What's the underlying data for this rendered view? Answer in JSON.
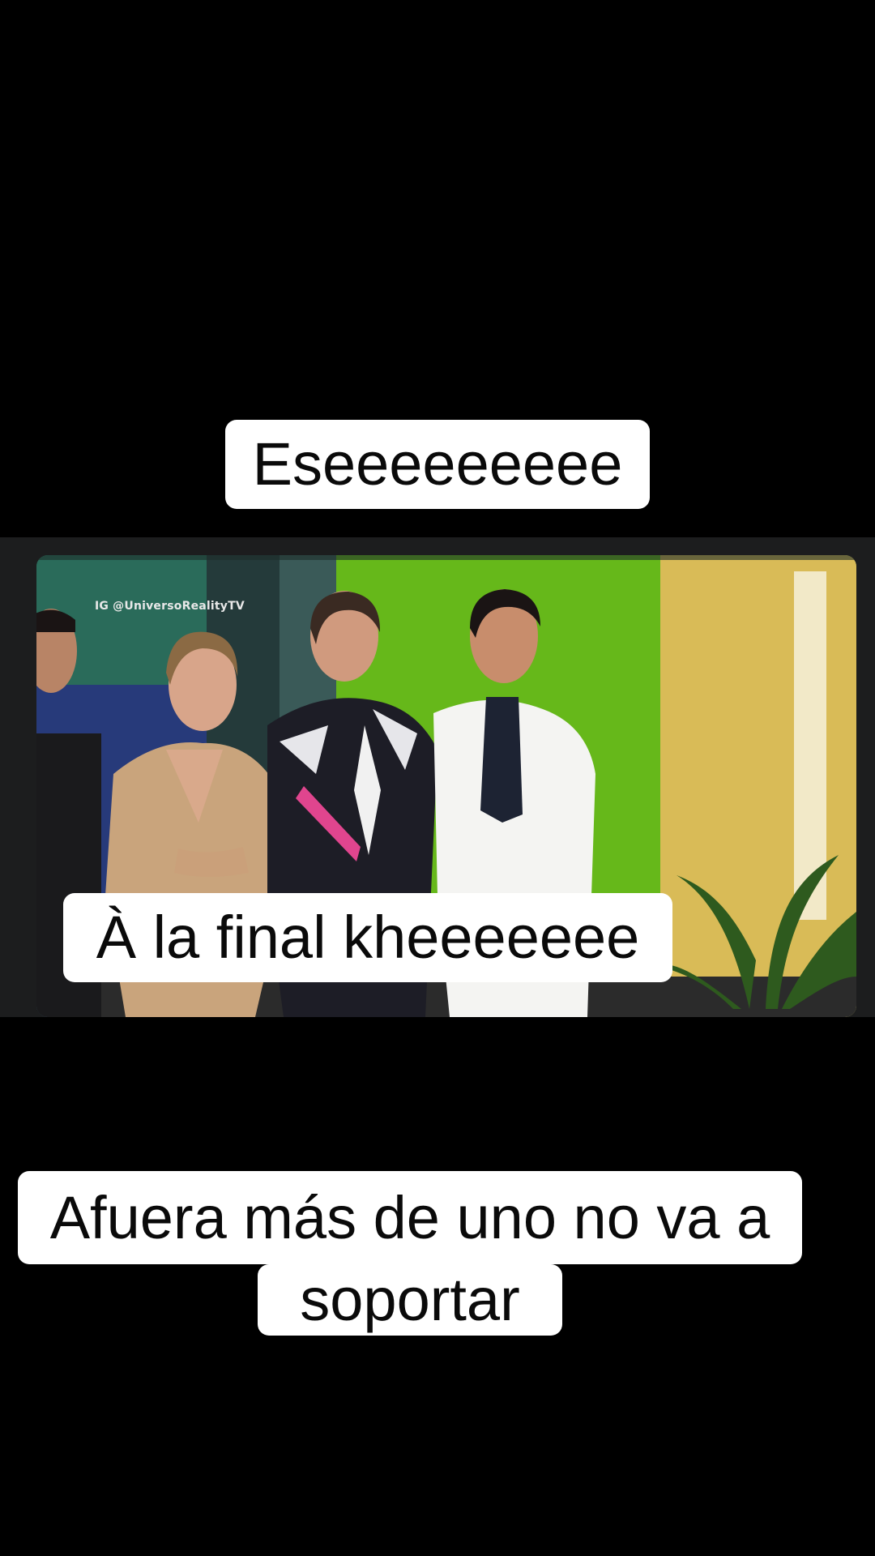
{
  "captions": {
    "top": "Eseeeeeeeee",
    "middle": "À la final kheeeeeee",
    "bottom_line1": "Afuera más de uno no va a",
    "bottom_line2": "soportar"
  },
  "video": {
    "watermark": "IG @UniversoRealityTV"
  },
  "colors": {
    "background": "#000000",
    "caption_bg": "#ffffff",
    "caption_text": "#0a0a0a",
    "scene_green": "#6cc21c",
    "scene_yellow": "#e2c65a"
  }
}
